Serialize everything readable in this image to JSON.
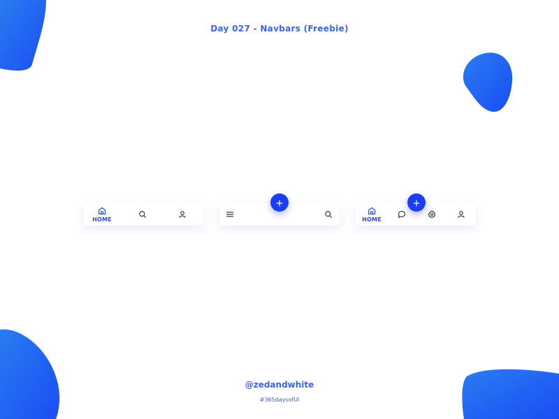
{
  "header": {
    "title": "Day 027 - Navbars (Freebie)"
  },
  "footer": {
    "handle": "@zedandwhite",
    "hashtag": "#365daysofUI"
  },
  "colors": {
    "accent": "#1c3df2",
    "text_accent": "#3f63e8",
    "icon": "#333a4a",
    "blob_start": "#2a7cf0",
    "blob_end": "#1a4ef5"
  },
  "navbar_1": {
    "items": [
      {
        "icon": "home-icon",
        "label": "HOME",
        "active": true
      },
      {
        "icon": "search-icon",
        "active": false
      },
      {
        "icon": "user-icon",
        "active": false
      }
    ]
  },
  "navbar_2": {
    "items": [
      {
        "icon": "menu-icon",
        "active": false
      },
      {
        "icon": "plus-icon",
        "active": false
      },
      {
        "icon": "search-icon",
        "active": false
      }
    ]
  },
  "navbar_3": {
    "items": [
      {
        "icon": "home-icon",
        "label": "HOME",
        "active": true
      },
      {
        "icon": "chat-icon",
        "active": false
      },
      {
        "icon": "plus-icon",
        "active": false
      },
      {
        "icon": "settings-icon",
        "active": false
      },
      {
        "icon": "user-icon",
        "active": false
      }
    ]
  }
}
